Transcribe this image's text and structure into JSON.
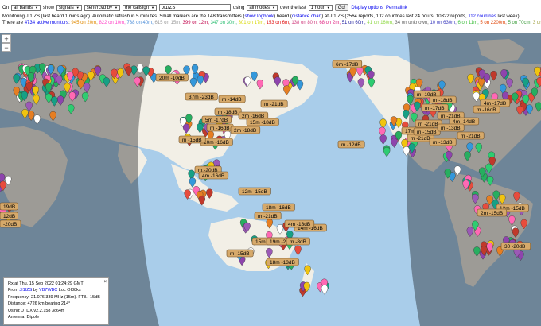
{
  "controls": {
    "on_label": "On",
    "band": "all bands",
    "show_label": "show",
    "show_value": "signals",
    "sent_value": "sent/rcvd by",
    "target_value": "the callsign",
    "callsign": "JI1IZS",
    "using_label": "using",
    "mode": "all modes",
    "over_label": "over the last",
    "period": "1 hour",
    "go_label": "Go!",
    "display_options": "Display options",
    "permalink": "Permalink"
  },
  "status": {
    "line1_a": "Monitoring JI1IZS (last heard 1 mins ago). Automatic refresh in 5 minutes. Small markers are the 148 transmitters (",
    "show_logbook": "show logbook",
    "line1_b": ") heard (",
    "distance_chart": "distance chart",
    "line1_c": ") at JI1IZS (2564 reports, 102 countries last 24 hours; 10322 reports, ",
    "countries_link": "112 countries",
    "line1_d": " last week)."
  },
  "monitors": {
    "prefix": "There are ",
    "count_link": "4734 active monitors",
    "colon": ": ",
    "bands": [
      {
        "text": "945 on 20m",
        "color": "#e08a00"
      },
      {
        "text": "822 on 10m",
        "color": "#ff44c8"
      },
      {
        "text": "738 on 40m",
        "color": "#4a8cd8"
      },
      {
        "text": "615 on 15m",
        "color": "#9c9c9c"
      },
      {
        "text": "399 on 12m",
        "color": "#c0004a"
      },
      {
        "text": "347 on 30m",
        "color": "#2fbf74"
      },
      {
        "text": "301 on 17m",
        "color": "#d8d800"
      },
      {
        "text": "153 on 6m",
        "color": "#e01010"
      },
      {
        "text": "138 on 80m",
        "color": "#d04080"
      },
      {
        "text": "68 on 2m",
        "color": "#e02080"
      },
      {
        "text": "51 on 60m",
        "color": "#2020a0"
      },
      {
        "text": "41 on 160m",
        "color": "#8cd840"
      },
      {
        "text": "34 on unknown",
        "color": "#666666"
      },
      {
        "text": "10 on 630m",
        "color": "#4040c0"
      },
      {
        "text": "6 on 11m",
        "color": "#40c040"
      },
      {
        "text": "5 on 2200m",
        "color": "#e04000"
      },
      {
        "text": "5 on 70cm",
        "color": "#40a040"
      },
      {
        "text": "3 on 4m",
        "color": "#a0a040"
      }
    ]
  },
  "map": {
    "zoom_in": "+",
    "zoom_out": "−",
    "ocean_color": "#a9cdea",
    "land_color": "#f2efe6",
    "night_color": "#000000",
    "labels": [
      {
        "id": "label-1",
        "text": "20m -10dB"
      },
      {
        "id": "label-2",
        "text": "37m -23dB"
      },
      {
        "id": "label-3",
        "text": "m -14dB"
      },
      {
        "id": "label-4",
        "text": "m -21dB"
      },
      {
        "id": "label-5",
        "text": "m -18dB"
      },
      {
        "id": "label-6",
        "text": "2m -16dB"
      },
      {
        "id": "label-7",
        "text": "5m -17dB"
      },
      {
        "id": "label-8",
        "text": "15m -18dB"
      },
      {
        "id": "label-9",
        "text": "m -16dB"
      },
      {
        "id": "label-10",
        "text": "2m -18dB"
      },
      {
        "id": "label-11",
        "text": "10m -16dB"
      },
      {
        "id": "label-12",
        "text": "m -15dB"
      },
      {
        "id": "label-13",
        "text": "m -20dB"
      },
      {
        "id": "label-14",
        "text": "4m -16dB"
      },
      {
        "id": "label-15",
        "text": "12m -15dB"
      },
      {
        "id": "label-16",
        "text": "m -21dB"
      },
      {
        "id": "label-17",
        "text": "15m -20dB"
      },
      {
        "id": "label-18",
        "text": "6m -17dB"
      },
      {
        "id": "label-19",
        "text": "m -12dB"
      },
      {
        "id": "label-20",
        "text": "m -19dB"
      },
      {
        "id": "label-21",
        "text": "m -18dB"
      },
      {
        "id": "label-22",
        "text": "m -17dB"
      },
      {
        "id": "label-23",
        "text": "m -21dB"
      },
      {
        "id": "label-24",
        "text": "4m -14dB"
      },
      {
        "id": "label-25",
        "text": "17m -16dB"
      },
      {
        "id": "label-26",
        "text": "m -21dB"
      },
      {
        "id": "label-27",
        "text": "m -13dB"
      },
      {
        "id": "label-28",
        "text": "m -21dB"
      },
      {
        "id": "label-29",
        "text": "18m -16dB"
      },
      {
        "id": "label-30",
        "text": "14m -16dB"
      },
      {
        "id": "label-31",
        "text": "m -15dB"
      },
      {
        "id": "label-32",
        "text": "18m -13dB"
      },
      {
        "id": "label-33",
        "text": "19m -21dB"
      },
      {
        "id": "label-34",
        "text": "m -8dB"
      },
      {
        "id": "label-35",
        "text": "4m -18dB"
      },
      {
        "id": "label-36",
        "text": "4m -17dB"
      },
      {
        "id": "label-37",
        "text": "m -16dB"
      },
      {
        "id": "label-38",
        "text": "m -21dB"
      },
      {
        "id": "label-39",
        "text": "m -15dB"
      },
      {
        "id": "label-40",
        "text": "m -13dB"
      },
      {
        "id": "label-41",
        "text": "12m -15dB"
      },
      {
        "id": "label-42",
        "text": "2m -15dB"
      },
      {
        "id": "label-43",
        "text": "19dB"
      },
      {
        "id": "label-44",
        "text": "12dB"
      },
      {
        "id": "label-45",
        "text": "-20dB"
      },
      {
        "id": "label-46",
        "text": "30 -20dB"
      }
    ]
  },
  "popup": {
    "close": "×",
    "line1": "Rx at Thu, 15 Sep 2022 01:24:29 GMT",
    "from_label": "From ",
    "from_call": "JI1IZS",
    "by_label": " by ",
    "by_call": "YB7WBC",
    "loc": " Loc OI88ks",
    "line3": "Frequency: 21.076 339 MHz (15m). FT8. -15dB",
    "line4": "Distance: 4726 km bearing 214°",
    "line5": "Using: JTDX v2.2.158 3c64ff",
    "line6": "Antenna: Dipole"
  }
}
